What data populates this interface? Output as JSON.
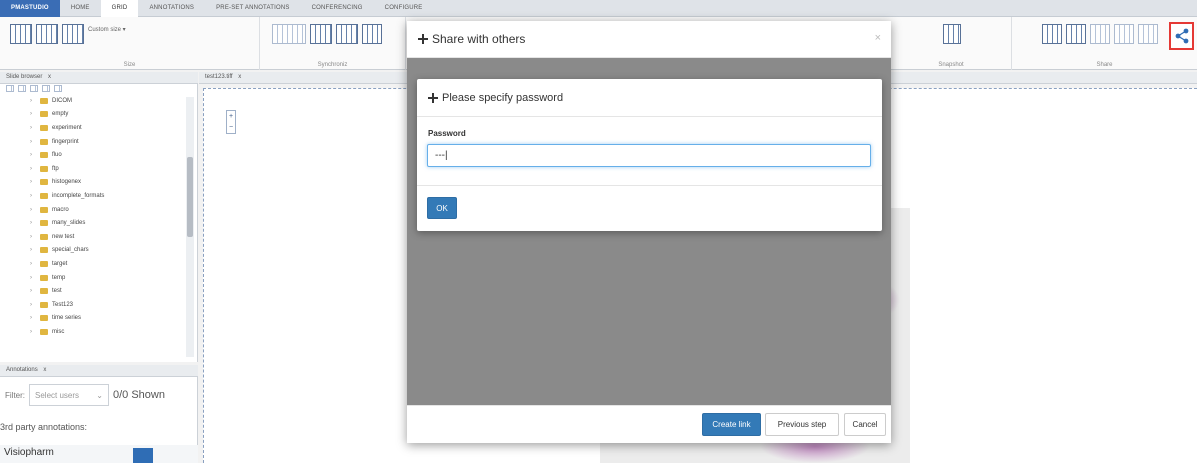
{
  "ribbon": {
    "tabs": [
      "PMASTUDIO",
      "HOME",
      "GRID",
      "ANNOTATIONS",
      "PRE-SET ANNOTATIONS",
      "CONFERENCING",
      "CONFIGURE"
    ],
    "custom_size": "Custom size ▾",
    "groups": {
      "size": "Size",
      "synchronize": "Synchroniz",
      "snapshot": "Snapshot",
      "share": "Share"
    }
  },
  "slide_browser": {
    "title": "Slide browser",
    "close": "x",
    "items": [
      "DICOM",
      "empty",
      "experiment",
      "fingerprint",
      "fluo",
      "ftp",
      "histogenex",
      "incomplete_formats",
      "macro",
      "many_slides",
      "new test",
      "special_chars",
      "target",
      "temp",
      "test",
      "Test123",
      "time series",
      "misc"
    ]
  },
  "viewer": {
    "tab_label": "test123.tiff",
    "close": "x"
  },
  "annotations_panel": {
    "title": "Annotations",
    "close": "x",
    "filter_label": "Filter:",
    "select_placeholder": "Select users",
    "shown": "0/0 Shown",
    "section": "3rd party annotations:",
    "row_label": "Visiopharm"
  },
  "share_dialog": {
    "title": "Share with others",
    "close": "×",
    "create_link": "Create link",
    "previous_step": "Previous step",
    "cancel": "Cancel"
  },
  "password_dialog": {
    "title": "Please specify password",
    "label": "Password",
    "value": "---|",
    "ok": "OK"
  },
  "colors": {
    "primary": "#337ab7",
    "highlight": "#e53935",
    "folder": "#e0b640"
  },
  "icons": {
    "move": "move-icon",
    "share": "share-icon"
  }
}
